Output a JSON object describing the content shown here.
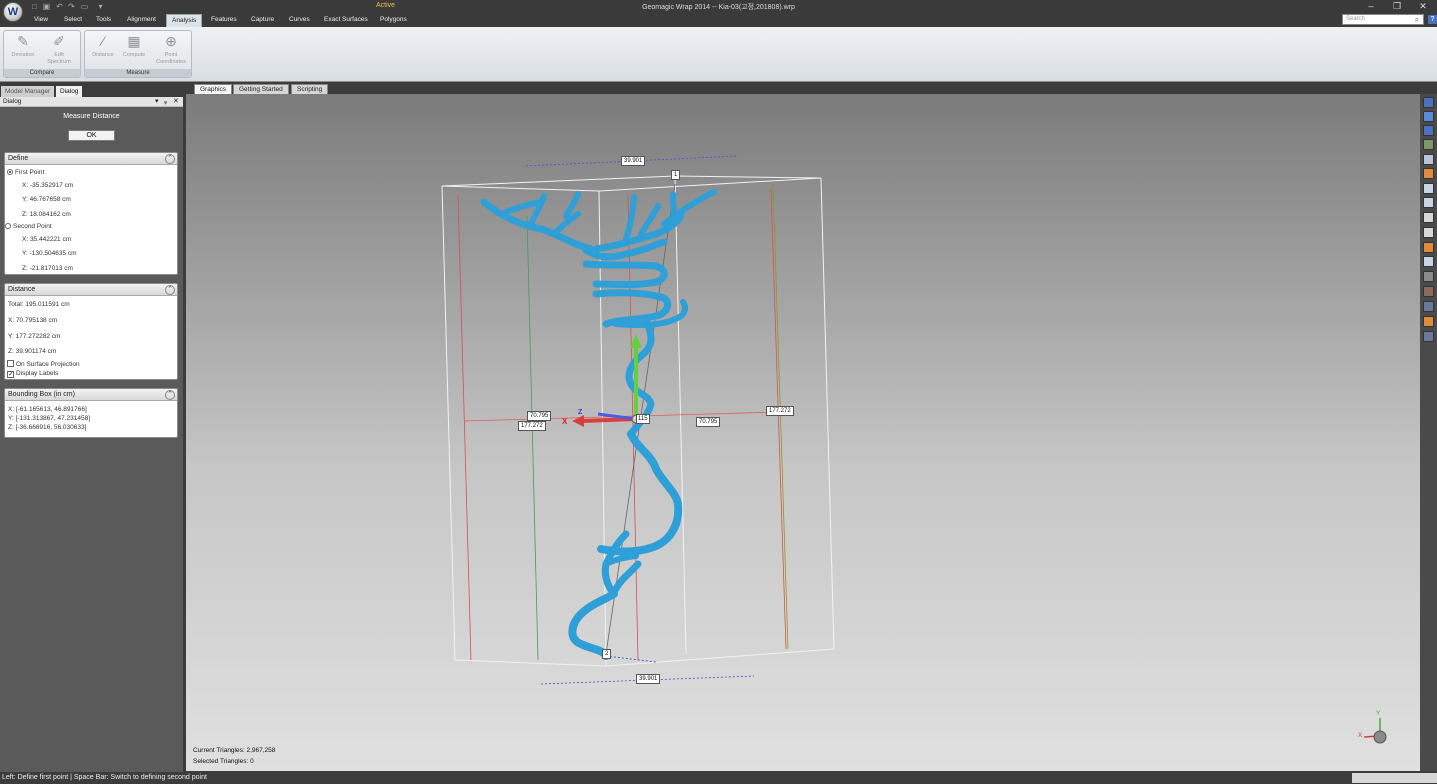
{
  "app": {
    "title": "Geomagic Wrap 2014 -- Kia-03(고정,201808).wrp",
    "status": "Active",
    "logo_letter": "W"
  },
  "menus": [
    "View",
    "Select",
    "Tools",
    "Alignment",
    "Analysis",
    "Features",
    "Capture",
    "Curves",
    "Exact Surfaces",
    "Polygons"
  ],
  "selected_menu": "Analysis",
  "search": {
    "placeholder": "Search"
  },
  "ribbon": {
    "groups": [
      {
        "label": "Compare",
        "buttons": [
          {
            "label": "Deviation",
            "icon": "deviation-icon"
          },
          {
            "label": "Edit Spectrum",
            "icon": "edit-spectrum-icon"
          }
        ]
      },
      {
        "label": "Measure",
        "buttons": [
          {
            "label": "Distance",
            "icon": "distance-icon"
          },
          {
            "label": "Compute",
            "icon": "calculator-icon"
          },
          {
            "label": "Point Coordinates",
            "icon": "point-coordinates-icon"
          }
        ]
      }
    ]
  },
  "left_tabs": [
    "Model Manager",
    "Dialog"
  ],
  "dialog": {
    "header": "Dialog",
    "title": "Measure Distance",
    "ok_label": "OK",
    "define": {
      "title": "Define",
      "first_point_label": "First Point",
      "first_x": "X:  -35.352917 cm",
      "first_y": "Y:  46.767658 cm",
      "first_z": "Z:  18.084162 cm",
      "second_point_label": "Second Point",
      "second_x": "X:  35.442221 cm",
      "second_y": "Y:  -130.504635 cm",
      "second_z": "Z:  -21.817013 cm"
    },
    "distance": {
      "title": "Distance",
      "total": "Total:  195.011591 cm",
      "x": "X:  70.795138 cm",
      "y": "Y:  177.272282 cm",
      "z": "Z:  39.901174 cm",
      "on_surface_label": "On Surface Projection",
      "on_surface_checked": false,
      "display_labels_label": "Display Labels",
      "display_labels_checked": true
    },
    "bbox": {
      "title": "Bounding Box (in cm)",
      "x": "X:  [-61.165613, 46.891766]",
      "y": "Y:  [-131.313867, 47.231458]",
      "z": "Z:  [-36.666916, 56.030633]"
    }
  },
  "viewport_tabs": [
    "Graphics",
    "Getting Started",
    "Scripting"
  ],
  "viewport": {
    "labels": {
      "top_z": "39.901",
      "bottom_z": "39.901",
      "x_left": "70.795",
      "x_right": "70.795",
      "y_left": "177.272",
      "y_right": "177.272",
      "point1": "1",
      "point2": "2",
      "center": "115"
    },
    "axis_x": "X",
    "axis_z": "Z",
    "current_triangles": "Current Triangles:  2,967,258",
    "selected_triangles": "Selected Triangles:  0",
    "triad_y": "Y",
    "triad_x": "X"
  },
  "colors": {
    "model": "#2f9fd8",
    "accent": "#4b72c0"
  },
  "status_bar": "Left: Define first point | Space Bar: Switch to defining second point"
}
